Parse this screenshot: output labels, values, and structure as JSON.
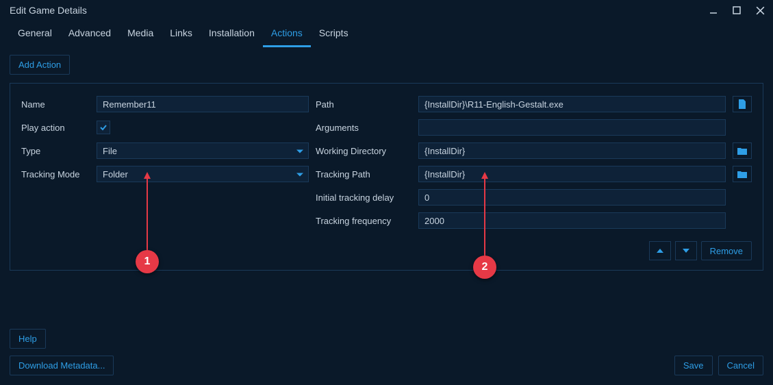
{
  "window": {
    "title": "Edit Game Details"
  },
  "tabs": {
    "general": "General",
    "advanced": "Advanced",
    "media": "Media",
    "links": "Links",
    "installation": "Installation",
    "actions": "Actions",
    "scripts": "Scripts"
  },
  "buttons": {
    "add_action": "Add Action",
    "remove": "Remove",
    "help": "Help",
    "download_metadata": "Download Metadata...",
    "save": "Save",
    "cancel": "Cancel"
  },
  "labels": {
    "name": "Name",
    "play_action": "Play action",
    "type": "Type",
    "tracking_mode": "Tracking Mode",
    "path": "Path",
    "arguments": "Arguments",
    "working_directory": "Working Directory",
    "tracking_path": "Tracking Path",
    "initial_tracking_delay": "Initial tracking delay",
    "tracking_frequency": "Tracking frequency"
  },
  "values": {
    "name": "Remember11",
    "play_action": true,
    "type": "File",
    "tracking_mode": "Folder",
    "path": "{InstallDir}\\R11-English-Gestalt.exe",
    "arguments": "",
    "working_directory": "{InstallDir}",
    "tracking_path": "{InstallDir}",
    "initial_tracking_delay": "0",
    "tracking_frequency": "2000"
  },
  "annotations": {
    "one": "1",
    "two": "2"
  }
}
